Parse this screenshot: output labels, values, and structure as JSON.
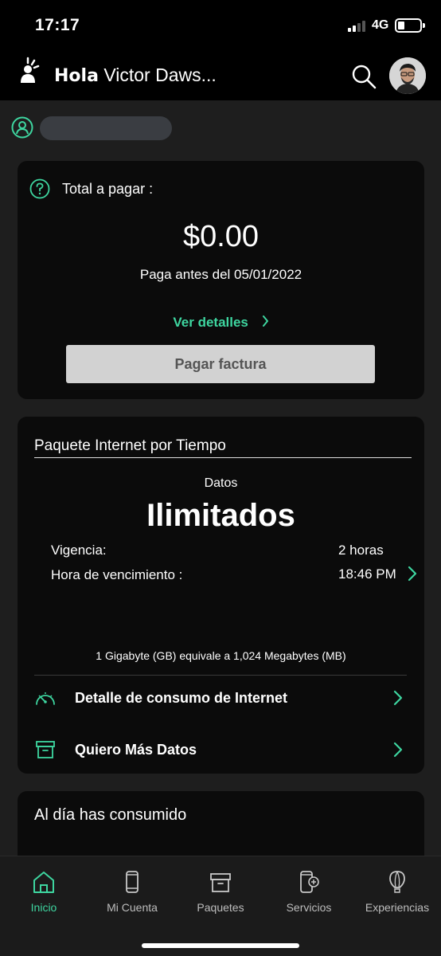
{
  "status_bar": {
    "time": "17:17",
    "network": "4G",
    "signal_bars": 4,
    "signal_bars_active": 2
  },
  "header": {
    "greeting_bold": "Hola",
    "user_name": "Victor Daws...",
    "icons": {
      "logo": "brand-logo-icon",
      "search": "search-icon",
      "avatar": "avatar"
    }
  },
  "account": {
    "icon": "user-circle-icon"
  },
  "bill_card": {
    "label": "Total a pagar :",
    "amount": "$0.00",
    "due_text": "Paga antes del 05/01/2022",
    "details_link": "Ver detalles",
    "pay_button": "Pagar factura"
  },
  "package_card": {
    "title": "Paquete Internet por Tiempo",
    "data_label": "Datos",
    "data_value": "Ilimitados",
    "validity_label": "Vigencia:",
    "validity_value": "2 horas",
    "expiry_label": "Hora de vencimiento :",
    "expiry_value": "18:46 PM",
    "note": "1 Gigabyte (GB) equivale a 1,024 Megabytes (MB)",
    "menu": [
      {
        "label": "Detalle de consumo de Internet",
        "icon": "speedometer-icon"
      },
      {
        "label": "Quiero Más Datos",
        "icon": "package-box-icon"
      }
    ]
  },
  "consumption_card": {
    "title": "Al día  has consumido"
  },
  "tabs": [
    {
      "label": "Inicio",
      "icon": "home-icon",
      "active": true
    },
    {
      "label": "Mi Cuenta",
      "icon": "phone-icon",
      "active": false
    },
    {
      "label": "Paquetes",
      "icon": "package-icon",
      "active": false
    },
    {
      "label": "Servicios",
      "icon": "phone-plus-icon",
      "active": false
    },
    {
      "label": "Experiencias",
      "icon": "balloon-icon",
      "active": false
    }
  ],
  "colors": {
    "accent": "#3ed6a0",
    "card_bg": "#0b0b0b",
    "page_bg": "#1e1e1e",
    "button_bg": "#d2d2d2"
  }
}
